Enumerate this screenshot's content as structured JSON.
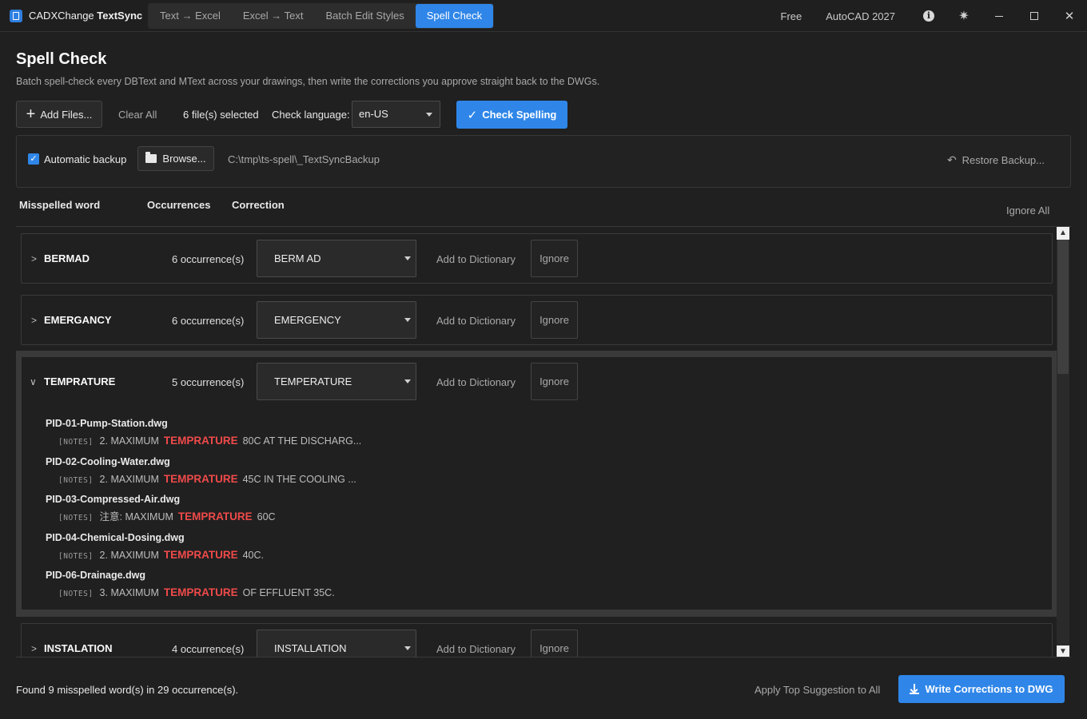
{
  "titlebar": {
    "app_name": "CADXChange",
    "app_name_bold": "TextSync",
    "tabs": [
      {
        "label": "Text → Excel"
      },
      {
        "label": "Excel → Text"
      },
      {
        "label": "Batch Edit Styles"
      },
      {
        "label": "Spell Check",
        "active": true
      }
    ],
    "plan": "Free",
    "autocad_version": "AutoCAD 2027",
    "icons": [
      "info-icon",
      "theme-icon",
      "minimize-icon",
      "maximize-icon",
      "close-icon"
    ]
  },
  "header": {
    "title": "Spell Check",
    "subtitle": "Batch spell-check every DBText and MText across your drawings, then write the corrections you approve straight back to the DWGs."
  },
  "toolbar": {
    "add_files": "Add Files...",
    "clear_all": "Clear All",
    "files_selected": "6 file(s) selected",
    "language_label": "Check language:",
    "language_value": "en-US",
    "check_spelling": "Check Spelling"
  },
  "backup": {
    "auto_backup_label": "Automatic backup",
    "auto_backup_checked": true,
    "browse": "Browse...",
    "path": "C:\\tmp\\ts-spell\\_TextSyncBackup",
    "restore": "Restore Backup..."
  },
  "columns": {
    "word": "Misspelled word",
    "occurrences": "Occurrences",
    "correction": "Correction",
    "ignore_all": "Ignore All"
  },
  "row_actions": {
    "add_dictionary": "Add to Dictionary",
    "ignore": "Ignore"
  },
  "words": [
    {
      "word": "BERMAD",
      "occurrences": "6 occurrence(s)",
      "correction": "BERM AD",
      "expanded": false
    },
    {
      "word": "EMERGANCY",
      "occurrences": "6 occurrence(s)",
      "correction": "EMERGENCY",
      "expanded": false
    },
    {
      "word": "TEMPRATURE",
      "occurrences": "5 occurrence(s)",
      "correction": "TEMPERATURE",
      "expanded": true,
      "details": [
        {
          "file": "PID-01-Pump-Station.dwg",
          "tag": "[NOTES]",
          "before": "2. MAXIMUM",
          "hit": "TEMPRATURE",
          "after": "80C AT THE DISCHARG..."
        },
        {
          "file": "PID-02-Cooling-Water.dwg",
          "tag": "[NOTES]",
          "before": "2. MAXIMUM",
          "hit": "TEMPRATURE",
          "after": "45C IN THE COOLING ..."
        },
        {
          "file": "PID-03-Compressed-Air.dwg",
          "tag": "[NOTES]",
          "before": "注意: MAXIMUM",
          "hit": "TEMPRATURE",
          "after": "60C"
        },
        {
          "file": "PID-04-Chemical-Dosing.dwg",
          "tag": "[NOTES]",
          "before": "2. MAXIMUM",
          "hit": "TEMPRATURE",
          "after": "40C."
        },
        {
          "file": "PID-06-Drainage.dwg",
          "tag": "[NOTES]",
          "before": "3. MAXIMUM",
          "hit": "TEMPRATURE",
          "after": "OF EFFLUENT 35C."
        }
      ]
    },
    {
      "word": "INSTALATION",
      "occurrences": "4 occurrence(s)",
      "correction": "INSTALLATION",
      "expanded": false
    }
  ],
  "footer": {
    "status": "Found 9 misspelled word(s) in 29 occurrence(s).",
    "apply_top": "Apply Top Suggestion to All",
    "write_corrections": "Write Corrections to DWG"
  }
}
